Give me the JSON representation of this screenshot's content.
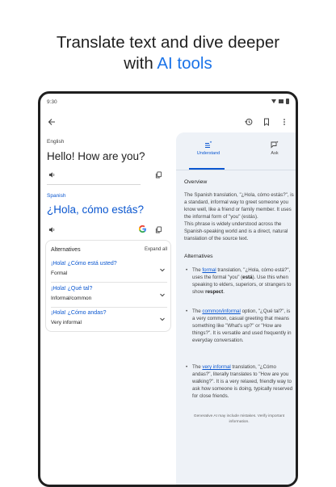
{
  "promo": {
    "headline_line1": "Translate text and dive deeper",
    "headline_line2_prefix": "with ",
    "headline_line2_accent": "AI tools"
  },
  "status": {
    "time": "9:30"
  },
  "appbar": {
    "back_icon": "arrow-back-icon",
    "history_icon": "history-icon",
    "bookmark_icon": "bookmark-icon",
    "more_icon": "more-vert-icon"
  },
  "source": {
    "language": "English",
    "text": "Hello! How are you?"
  },
  "target": {
    "language": "Spanish",
    "text": "¿Hola, cómo estás?"
  },
  "alternatives": {
    "title": "Alternatives",
    "expand_label": "Expand all",
    "items": [
      {
        "text": "¡Hola! ¿Cómo está usted?",
        "register": "Formal"
      },
      {
        "text": "¡Hola! ¿Qué tal?",
        "register": "Informal/common"
      },
      {
        "text": "¡Hola! ¿Cómo andas?",
        "register": "Very informal"
      }
    ]
  },
  "panel": {
    "tabs": [
      {
        "label": "Understand",
        "icon": "list-sparkle-icon"
      },
      {
        "label": "Ask",
        "icon": "chat-sparkle-icon"
      }
    ],
    "overview_title": "Overview",
    "overview_text": "The Spanish translation, \"¿Hola, cómo estás?\", is a standard, informal way to greet someone you know well, like a friend or family member. It uses the informal form of \"you\" (estás).",
    "overview_text2": "This phrase is widely understood across the Spanish-speaking world and is a direct, natural translation of the source text.",
    "alternatives_title": "Alternatives",
    "bullets": [
      {
        "pre": "The ",
        "kw": "formal",
        "post_a": " translation, \"¿Hola, cómo está?\", uses the formal \"you\" (",
        "bold1": "está",
        "post_b": "). Use this when speaking to elders, superiors, or strangers to show ",
        "bold2": "respect",
        "post_c": "."
      },
      {
        "pre": "The ",
        "kw": "common/informal",
        "post_a": " option, \"¿Qué tal?\", is a very common, casual greeting that means something like \"What's up?\" or \"How are things?\". It is versatile and used frequently in everyday conversation."
      },
      {
        "pre": "The ",
        "kw": "very informal",
        "post_a": " translation, \"¿Cómo andas?\", literally translates to \"How are you walking?\". It is a very relaxed, friendly way to ask how someone is doing, typically reserved for close friends."
      }
    ],
    "disclaimer": "Generative AI may include mistakes. Verify important information."
  },
  "colors": {
    "accent": "#1a73e8",
    "link": "#0b57d0",
    "panel_bg": "#eef2f7"
  }
}
